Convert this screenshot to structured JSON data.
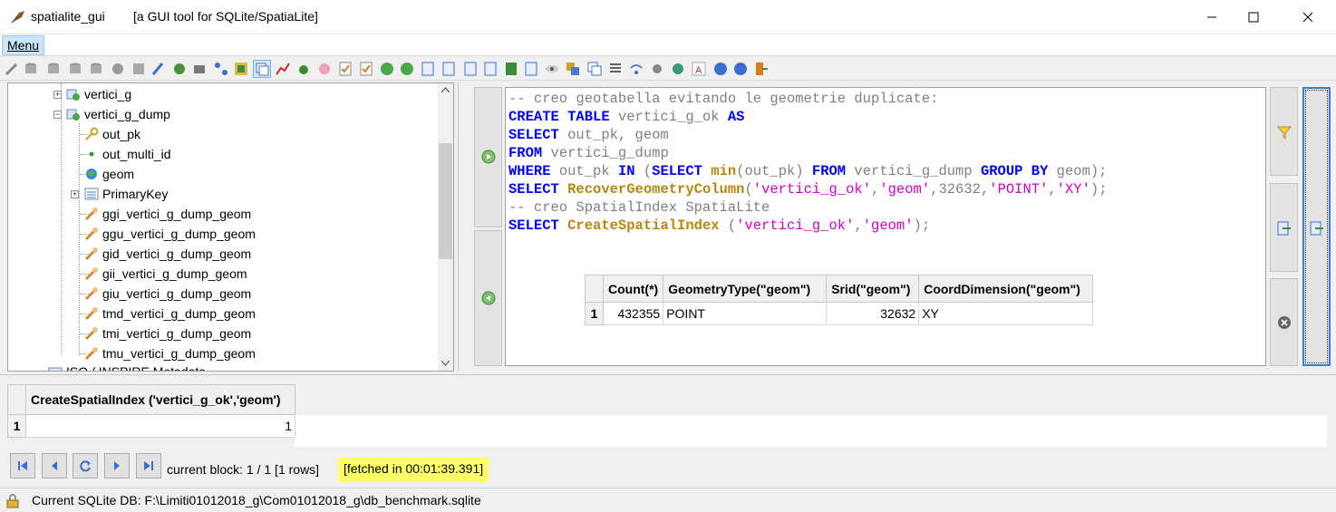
{
  "window": {
    "app_name": "spatialite_gui",
    "subtitle": "[a GUI tool for SQLite/SpatiaLite]"
  },
  "menubar": {
    "menu_label": "Menu"
  },
  "tree": {
    "items": [
      {
        "label": "vertici_g",
        "icon": "table-icon"
      },
      {
        "label": "vertici_g_dump",
        "icon": "table-icon"
      },
      {
        "label": "out_pk",
        "icon": "key-icon"
      },
      {
        "label": "out_multi_id",
        "icon": "column-icon"
      },
      {
        "label": "geom",
        "icon": "geometry-icon"
      },
      {
        "label": "PrimaryKey",
        "icon": "index-icon"
      },
      {
        "label": "ggi_vertici_g_dump_geom",
        "icon": "trigger-icon"
      },
      {
        "label": "ggu_vertici_g_dump_geom",
        "icon": "trigger-icon"
      },
      {
        "label": "gid_vertici_g_dump_geom",
        "icon": "trigger-icon"
      },
      {
        "label": "gii_vertici_g_dump_geom",
        "icon": "trigger-icon"
      },
      {
        "label": "giu_vertici_g_dump_geom",
        "icon": "trigger-icon"
      },
      {
        "label": "tmd_vertici_g_dump_geom",
        "icon": "trigger-icon"
      },
      {
        "label": "tmi_vertici_g_dump_geom",
        "icon": "trigger-icon"
      },
      {
        "label": "tmu_vertici_g_dump_geom",
        "icon": "trigger-icon"
      },
      {
        "label": "ISO / INSPIRE Metadata",
        "icon": "folder-icon"
      }
    ]
  },
  "sql": {
    "lines": [
      [
        {
          "t": "com",
          "v": "-- creo geotabella evitando le geometrie duplicate:"
        }
      ],
      [
        {
          "t": "kw",
          "v": "CREATE TABLE"
        },
        {
          "t": "id",
          "v": " vertici_g_ok "
        },
        {
          "t": "kw",
          "v": "AS"
        }
      ],
      [
        {
          "t": "kw",
          "v": "SELECT"
        },
        {
          "t": "id",
          "v": " out_pk, geom"
        }
      ],
      [
        {
          "t": "kw",
          "v": "FROM"
        },
        {
          "t": "id",
          "v": " vertici_g_dump"
        }
      ],
      [
        {
          "t": "kw",
          "v": "WHERE"
        },
        {
          "t": "id",
          "v": " out_pk "
        },
        {
          "t": "kw",
          "v": "IN"
        },
        {
          "t": "id",
          "v": " ("
        },
        {
          "t": "kw",
          "v": "SELECT"
        },
        {
          "t": "id",
          "v": " "
        },
        {
          "t": "fn",
          "v": "min"
        },
        {
          "t": "id",
          "v": "(out_pk) "
        },
        {
          "t": "kw",
          "v": "FROM"
        },
        {
          "t": "id",
          "v": " vertici_g_dump "
        },
        {
          "t": "kw",
          "v": "GROUP BY"
        },
        {
          "t": "id",
          "v": " geom);"
        }
      ],
      [
        {
          "t": "kw",
          "v": "SELECT"
        },
        {
          "t": "id",
          "v": " "
        },
        {
          "t": "fn",
          "v": "RecoverGeometryColumn"
        },
        {
          "t": "id",
          "v": "("
        },
        {
          "t": "str",
          "v": "'vertici_g_ok'"
        },
        {
          "t": "id",
          "v": ","
        },
        {
          "t": "str",
          "v": "'geom'"
        },
        {
          "t": "id",
          "v": ",32632,"
        },
        {
          "t": "str",
          "v": "'POINT'"
        },
        {
          "t": "id",
          "v": ","
        },
        {
          "t": "str",
          "v": "'XY'"
        },
        {
          "t": "id",
          "v": ");"
        }
      ],
      [
        {
          "t": "com",
          "v": "-- creo SpatialIndex SpatiaLite"
        }
      ],
      [
        {
          "t": "kw",
          "v": "SELECT"
        },
        {
          "t": "id",
          "v": " "
        },
        {
          "t": "fn",
          "v": "CreateSpatialIndex"
        },
        {
          "t": "id",
          "v": " ("
        },
        {
          "t": "str",
          "v": "'vertici_g_ok'"
        },
        {
          "t": "id",
          "v": ","
        },
        {
          "t": "str",
          "v": "'geom'"
        },
        {
          "t": "id",
          "v": ");"
        }
      ]
    ]
  },
  "inline_table": {
    "headers": [
      "Count(*)",
      "GeometryType(\"geom\")",
      "Srid(\"geom\")",
      "CoordDimension(\"geom\")"
    ],
    "row_number": "1",
    "row": [
      "432355",
      "POINT",
      "32632",
      "XY"
    ]
  },
  "result_table": {
    "header": "CreateSpatialIndex ('vertici_g_ok','geom')",
    "row_number": "1",
    "value": "1"
  },
  "navigation": {
    "block_info": "current block: 1 / 1 [1 rows]",
    "fetched": "[fetched in 00:01:39.391]"
  },
  "status": {
    "db_path": "Current SQLite DB: F:\\Limiti01012018_g\\Com01012018_g\\db_benchmark.sqlite"
  }
}
